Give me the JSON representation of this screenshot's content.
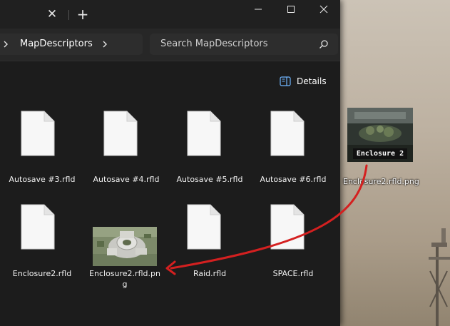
{
  "titlebar": {
    "tab_close_glyph": "✕",
    "new_tab_glyph": "+"
  },
  "toolbar": {
    "breadcrumb": "MapDescriptors",
    "search_placeholder": "Search MapDescriptors"
  },
  "cmdbar": {
    "details_label": "Details"
  },
  "files": [
    {
      "name": "Autosave #3.rfld",
      "type": "document"
    },
    {
      "name": "Autosave #4.rfld",
      "type": "document"
    },
    {
      "name": "Autosave #5.rfld",
      "type": "document"
    },
    {
      "name": "Autosave #6.rfld",
      "type": "document"
    },
    {
      "name": "Enclosure2.rfld",
      "type": "document"
    },
    {
      "name": "Enclosure2.rfld.pn",
      "name_line2": "g",
      "type": "image"
    },
    {
      "name": "Raid.rfld",
      "type": "document"
    },
    {
      "name": "SPACE.rfld",
      "type": "document"
    }
  ],
  "dragged_file": {
    "name": "Enclosure2.rfld.png",
    "thumbnail_caption": "Enclosure 2"
  },
  "colors": {
    "window_bg": "#1c1c1c",
    "arrow": "#d42020"
  }
}
